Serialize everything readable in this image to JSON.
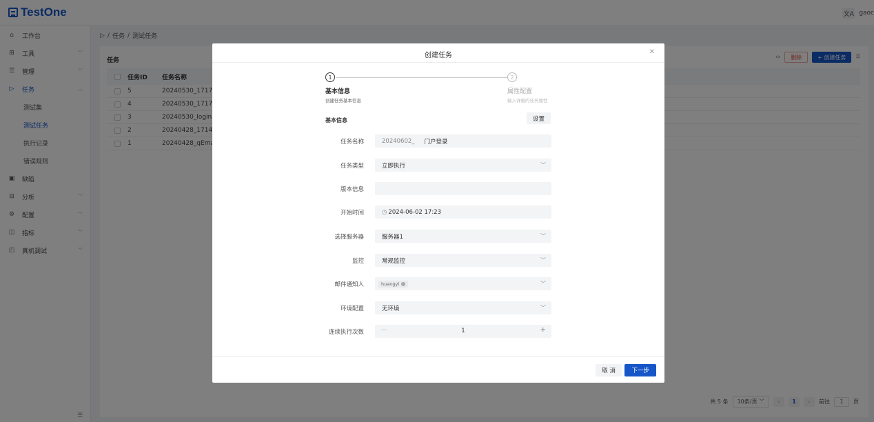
{
  "app": {
    "logo_text": "TestOne",
    "username": "gaoc",
    "translate_icon": "文A"
  },
  "sidebar": {
    "items": [
      {
        "label": "工作台",
        "icon": "home-icon"
      },
      {
        "label": "工具",
        "icon": "grid-icon"
      },
      {
        "label": "管理",
        "icon": "list-icon"
      },
      {
        "label": "任务",
        "icon": "play-icon"
      },
      {
        "label": "缺陷",
        "icon": "bug-icon"
      },
      {
        "label": "分析",
        "icon": "chart-icon"
      },
      {
        "label": "配置",
        "icon": "gear-icon"
      },
      {
        "label": "指标",
        "icon": "panel-icon"
      },
      {
        "label": "真机调试",
        "icon": "device-icon"
      }
    ],
    "sub_items": [
      "测试集",
      "测试任务",
      "执行记录",
      "错误规则"
    ]
  },
  "breadcrumb": {
    "level1": "任务",
    "level2": "测试任务"
  },
  "page": {
    "title": "任务",
    "delete_label": "删除",
    "create_label": "+ 创建任务",
    "columns": {
      "id": "任务ID",
      "name": "任务名称"
    },
    "rows": [
      {
        "id": "5",
        "name": "20240530_1717"
      },
      {
        "id": "4",
        "name": "20240530_1717"
      },
      {
        "id": "3",
        "name": "20240530_login"
      },
      {
        "id": "2",
        "name": "20240428_1714"
      },
      {
        "id": "1",
        "name": "20240428_qEma"
      }
    ],
    "pagination": {
      "total": "共 5 条",
      "page_size": "10条/页",
      "current": "1",
      "goto_label": "前往",
      "goto_value": "1",
      "page_unit": "页"
    }
  },
  "modal": {
    "title": "创建任务",
    "steps": [
      {
        "num": "1",
        "title": "基本信息",
        "desc": "创建任务基本信息"
      },
      {
        "num": "2",
        "title": "属性配置",
        "desc": "输入详细的任务属性"
      }
    ],
    "section_title": "基本信息",
    "settings_label": "设置",
    "fields": {
      "task_name": {
        "label": "任务名称",
        "prefix": "20240602_",
        "value": "门户登录"
      },
      "task_type": {
        "label": "任务类型",
        "value": "立即执行"
      },
      "version": {
        "label": "版本信息",
        "value": ""
      },
      "start_time": {
        "label": "开始时间",
        "value": "2024-06-02 17:23"
      },
      "server": {
        "label": "选择服务器",
        "value": "服务器1"
      },
      "monitor": {
        "label": "监控",
        "value": "常规监控"
      },
      "mail": {
        "label": "邮件通知人",
        "tag": "huangyl"
      },
      "env": {
        "label": "环境配置",
        "value": "无环境"
      },
      "repeat": {
        "label": "连续执行次数",
        "value": "1"
      }
    },
    "cancel_label": "取 消",
    "next_label": "下一步"
  },
  "colors": {
    "primary": "#1756c8",
    "danger": "#e74c3c"
  }
}
